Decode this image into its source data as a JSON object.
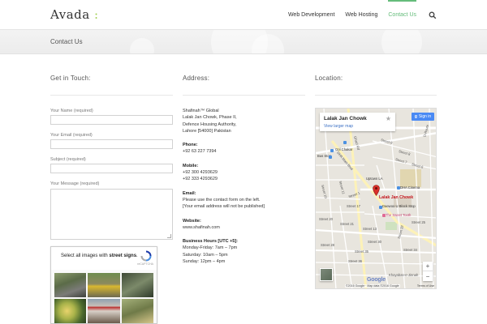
{
  "header": {
    "logo_main": "Avada",
    "logo_accent": " :",
    "nav": [
      {
        "label": "Web Development"
      },
      {
        "label": "Web Hosting"
      },
      {
        "label": "Contact Us"
      }
    ],
    "active_nav": "Contact Us"
  },
  "titlebar": {
    "title": "Contact Us"
  },
  "columns": {
    "get_in_touch": "Get in Touch:",
    "address": "Address:",
    "location": "Location:"
  },
  "form": {
    "name_label": "Your Name (required)",
    "email_label": "Your Email (required)",
    "subject_label": "Subject (required)",
    "message_label": "Your Message (required)"
  },
  "captcha": {
    "instruction_prefix": "Select all images with ",
    "instruction_bold": "street signs",
    "instruction_suffix": ".",
    "brand": "reCAPTCHA"
  },
  "address": {
    "company": "Shafinah™ Global",
    "line1": "Lalak Jan Chowk, Phase II,",
    "line2": "Defence Housing Authority,",
    "line3": "Lahore [54000] Pakistan",
    "phone_label": "Phone:",
    "phone": "+92 63 227 7394",
    "mobile_label": "Mobile:",
    "mobile1": "+92 300 4293629",
    "mobile2": "+92 333 4293629",
    "email_label": "Email:",
    "email_line1": "Please use the contact form on the left.",
    "email_line2": "[Your email address will not be published]",
    "website_label": "Website:",
    "website": "www.shafinah.com",
    "hours_label": "Business Hours [UTC +5]:",
    "hours1": "Monday-Friday: 7am – 7pm",
    "hours2": "Saturday: 10am – 5pm",
    "hours3": "Sunday: 12pm – 4pm"
  },
  "map": {
    "card_title": "Lalak Jan Chowk",
    "card_link": "View larger map",
    "signin": "Sign in",
    "pin_label": "Lalak Jan Chowk",
    "attribution": "©2016 Google · Map data ©2016 Google",
    "terms": "Terms of Use",
    "google": "Google",
    "labels": {
      "bus_stop": "Bus Stop",
      "gol_chakar": "Gol Chakar",
      "dha_cinema": "DHA Cinema",
      "uptown": "Uptown LA",
      "daewoo": "Daewoo U Block Stop",
      "sweet_tooth": "The Sweet Tooth",
      "khayaban": "Khayaban-e-Jinnah",
      "street9": "Street 9",
      "street8": "Street 8",
      "street7": "Street 7",
      "street6": "Street 6",
      "street10": "Street 10",
      "street11": "Street 11",
      "street17": "Street 17",
      "street20": "Street 20",
      "street21": "Street 21",
      "street28": "Street 28",
      "street30": "Street 30",
      "street32": "Street 32",
      "street34": "Street 34",
      "street35": "Street 35",
      "street36": "Street 36",
      "dha_main": "DHA Main Blvd",
      "ghazi_rd": "Ghazi Rd",
      "d_route": "D-Route",
      "street1": "Street 1",
      "street13": "Street 13",
      "street25": "Street 25"
    }
  },
  "colors": {
    "accent": "#65bc7b",
    "logo_accent": "#a0ce4e",
    "pin": "#c3141b",
    "link": "#3a6fc4"
  }
}
